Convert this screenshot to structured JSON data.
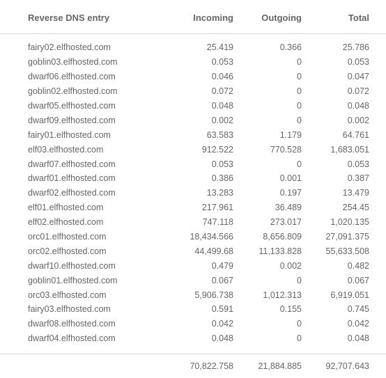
{
  "table": {
    "headers": {
      "name": "Reverse DNS entry",
      "incoming": "Incoming",
      "outgoing": "Outgoing",
      "total": "Total"
    },
    "rows": [
      {
        "name": "fairy02.elfhosted.com",
        "incoming": "25.419",
        "outgoing": "0.366",
        "total": "25.786"
      },
      {
        "name": "goblin03.elfhosted.com",
        "incoming": "0.053",
        "outgoing": "0",
        "total": "0.053"
      },
      {
        "name": "dwarf06.elfhosted.com",
        "incoming": "0.046",
        "outgoing": "0",
        "total": "0.047"
      },
      {
        "name": "goblin02.elfhosted.com",
        "incoming": "0.072",
        "outgoing": "0",
        "total": "0.072"
      },
      {
        "name": "dwarf05.elfhosted.com",
        "incoming": "0.048",
        "outgoing": "0",
        "total": "0.048"
      },
      {
        "name": "dwarf09.elfhosted.com",
        "incoming": "0.002",
        "outgoing": "0",
        "total": "0.002"
      },
      {
        "name": "fairy01.elfhosted.com",
        "incoming": "63.583",
        "outgoing": "1.179",
        "total": "64.761"
      },
      {
        "name": "elf03.elfhosted.com",
        "incoming": "912.522",
        "outgoing": "770.528",
        "total": "1,683.051"
      },
      {
        "name": "dwarf07.elfhosted.com",
        "incoming": "0.053",
        "outgoing": "0",
        "total": "0.053"
      },
      {
        "name": "dwarf01.elfhosted.com",
        "incoming": "0.386",
        "outgoing": "0.001",
        "total": "0.387"
      },
      {
        "name": "dwarf02.elfhosted.com",
        "incoming": "13.283",
        "outgoing": "0.197",
        "total": "13.479"
      },
      {
        "name": "elf01.elfhosted.com",
        "incoming": "217.961",
        "outgoing": "36.489",
        "total": "254.45"
      },
      {
        "name": "elf02.elfhosted.com",
        "incoming": "747.118",
        "outgoing": "273.017",
        "total": "1,020.135"
      },
      {
        "name": "orc01.elfhosted.com",
        "incoming": "18,434.566",
        "outgoing": "8,656.809",
        "total": "27,091.375"
      },
      {
        "name": "orc02.elfhosted.com",
        "incoming": "44,499.68",
        "outgoing": "11,133.828",
        "total": "55,633.508"
      },
      {
        "name": "dwarf10.elfhosted.com",
        "incoming": "0.479",
        "outgoing": "0.002",
        "total": "0.482"
      },
      {
        "name": "goblin01.elfhosted.com",
        "incoming": "0.067",
        "outgoing": "0",
        "total": "0.067"
      },
      {
        "name": "orc03.elfhosted.com",
        "incoming": "5,906.738",
        "outgoing": "1,012.313",
        "total": "6,919.051"
      },
      {
        "name": "fairy03.elfhosted.com",
        "incoming": "0.591",
        "outgoing": "0.155",
        "total": "0.745"
      },
      {
        "name": "dwarf08.elfhosted.com",
        "incoming": "0.042",
        "outgoing": "0",
        "total": "0.042"
      },
      {
        "name": "dwarf04.elfhosted.com",
        "incoming": "0.048",
        "outgoing": "0",
        "total": "0.048"
      }
    ],
    "totals": {
      "name": "",
      "incoming": "70,822.758",
      "outgoing": "21,884.885",
      "total": "92,707.643"
    }
  },
  "colors": {
    "text": "#666666",
    "divider": "#d6d6d6",
    "background": "#ffffff"
  }
}
